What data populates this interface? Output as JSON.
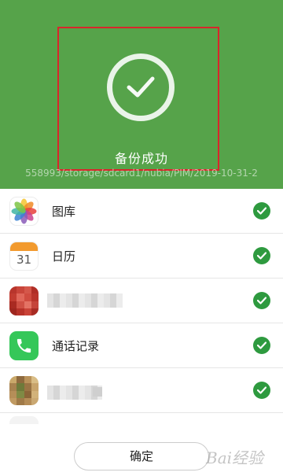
{
  "colors": {
    "accent": "#56a34a",
    "highlight_border": "#d9262b",
    "check_badge": "#2e9a3f"
  },
  "status": {
    "icon": "checkmark-ring-icon",
    "text": "备份成功",
    "path": "558993/storage/sdcard1/nubia/PIM/2019-10-31-2"
  },
  "list": {
    "items": [
      {
        "icon": "photos-icon",
        "label": "图库",
        "checked": true
      },
      {
        "icon": "calendar-icon",
        "day": "31",
        "label": "日历",
        "checked": true
      },
      {
        "icon": "blurred-app-icon",
        "label": "",
        "checked": true
      },
      {
        "icon": "phone-icon",
        "label": "通话记录",
        "checked": true
      },
      {
        "icon": "blurred-app-icon",
        "label": "",
        "checked": true
      }
    ]
  },
  "footer": {
    "confirm_label": "确定"
  },
  "watermark": {
    "text": "Bai经验"
  }
}
